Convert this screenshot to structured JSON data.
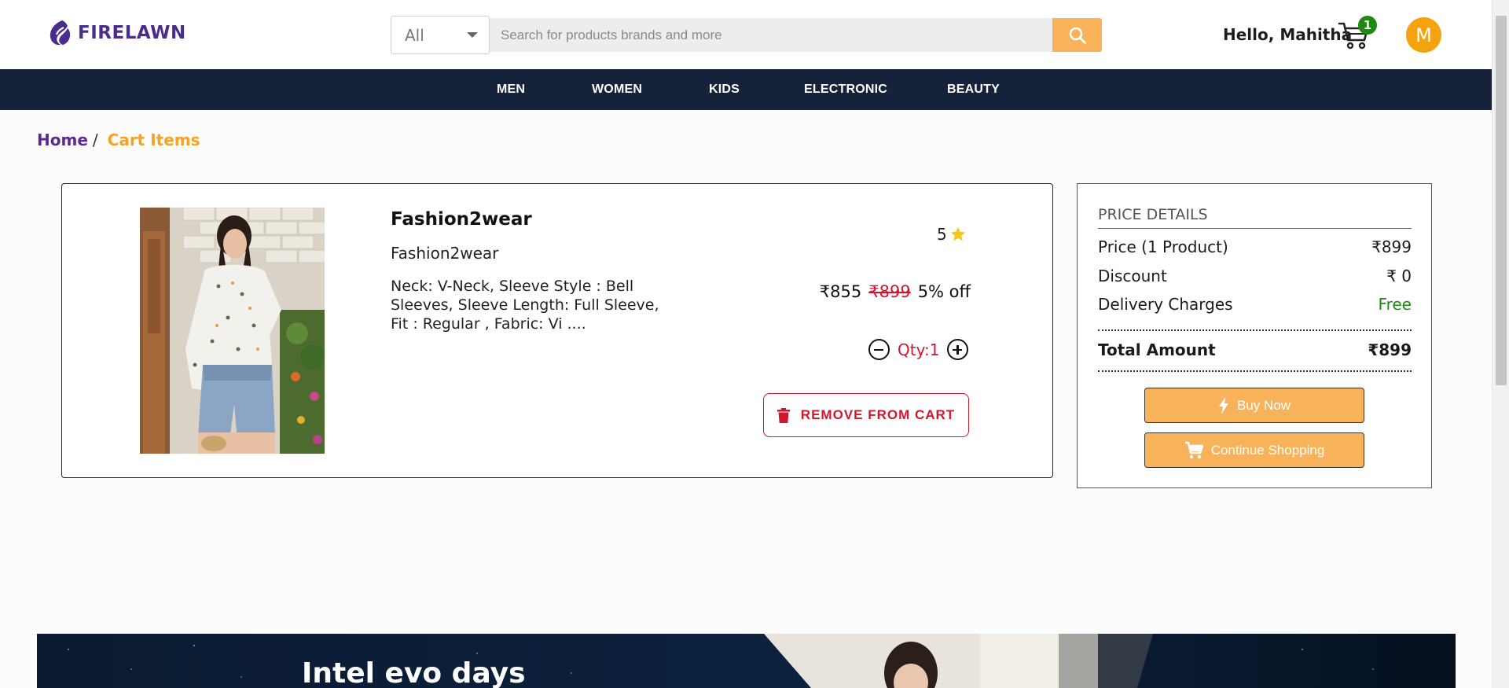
{
  "brand": {
    "name": "FIRELAWN",
    "color": "#4a2c8a"
  },
  "search": {
    "category": "All",
    "placeholder": "Search for products brands and more",
    "icon": "search-icon",
    "accent": "#f7b25a"
  },
  "header": {
    "greeting": "Hello, Mahitha",
    "cart_count": "1",
    "avatar_initial": "M"
  },
  "nav": {
    "items": [
      "MEN",
      "WOMEN",
      "KIDS",
      "ELECTRONIC",
      "BEAUTY"
    ]
  },
  "breadcrumb": {
    "home": "Home",
    "separator": "/",
    "current": "Cart Items"
  },
  "cart_item": {
    "title": "Fashion2wear",
    "brand": "Fashion2wear",
    "description": "Neck: V-Neck, Sleeve Style : Bell Sleeves, Sleeve Length: Full Sleeve, Fit : Regular , Fabric: Vi ....",
    "rating": "5",
    "price": "₹855",
    "original_price": "₹899",
    "discount": "5% off",
    "quantity_label": "Qty:1",
    "remove_label": "REMOVE FROM CART"
  },
  "price_details": {
    "title": "PRICE DETAILS",
    "rows": [
      {
        "label": "Price (1 Product)",
        "value": "₹899"
      },
      {
        "label": "Discount",
        "value": "₹ 0"
      },
      {
        "label": "Delivery Charges",
        "value": "Free"
      }
    ],
    "total_label": "Total Amount",
    "total_value": "₹899",
    "buy_now": "Buy Now",
    "continue_shopping": "Continue Shopping"
  },
  "banner": {
    "title": "Intel evo days"
  }
}
